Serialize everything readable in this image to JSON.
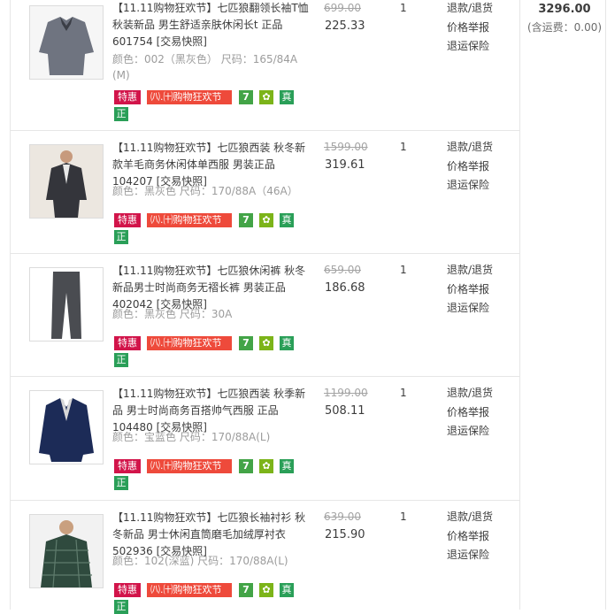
{
  "order_summary": {
    "total": "3296.00",
    "shipping_note": "(含运费：0.00)"
  },
  "items": [
    {
      "title": "【11.11购物狂欢节】七匹狼翻领长袖T恤 秋装新品 男生舒适亲肤休闲长t 正品601754 [交易快照]",
      "attrs": "颜色：002（黑灰色） 尺码：165/84A (M)",
      "price_old": "699.00",
      "price_now": "225.33",
      "qty": "1",
      "actions": [
        "退款/退货",
        "价格举报",
        "退运保险"
      ],
      "tags": {
        "sale": "特惠",
        "festival": "㈧.㈩购物狂欢节",
        "seven": "7",
        "bag": "✿",
        "genuine": "真",
        "genuine2": "正"
      },
      "thumb_colors": {
        "main": "#6f7480",
        "accent": "#3b3e46"
      }
    },
    {
      "title": "【11.11购物狂欢节】七匹狼西装 秋冬新款羊毛商务休闲体单西服 男装正品104207 [交易快照]",
      "attrs": "颜色：黑灰色 尺码：170/88A（46A）",
      "price_old": "1599.00",
      "price_now": "319.61",
      "qty": "1",
      "actions": [
        "退款/退货",
        "价格举报",
        "退运保险"
      ],
      "tags": {
        "sale": "特惠",
        "festival": "㈧.㈩购物狂欢节",
        "seven": "7",
        "bag": "✿",
        "genuine": "真",
        "genuine2": "正"
      },
      "thumb_colors": {
        "main": "#34353b",
        "accent": "#2a2b30"
      }
    },
    {
      "title": "【11.11购物狂欢节】七匹狼休闲裤 秋冬新品男士时尚商务无褶长裤 男装正品402042 [交易快照]",
      "attrs": "颜色：黑灰色 尺码：30A",
      "price_old": "659.00",
      "price_now": "186.68",
      "qty": "1",
      "actions": [
        "退款/退货",
        "价格举报",
        "退运保险"
      ],
      "tags": {
        "sale": "特惠",
        "festival": "㈧.㈩购物狂欢节",
        "seven": "7",
        "bag": "✿",
        "genuine": "真",
        "genuine2": "正"
      },
      "thumb_colors": {
        "main": "#4a4c51",
        "accent": "#3a3c40"
      }
    },
    {
      "title": "【11.11购物狂欢节】七匹狼西装 秋季新品 男士时尚商务百搭帅气西服 正品104480 [交易快照]",
      "attrs": "颜色：宝蓝色 尺码：170/88A(L)",
      "price_old": "1199.00",
      "price_now": "508.11",
      "qty": "1",
      "actions": [
        "退款/退货",
        "价格举报",
        "退运保险"
      ],
      "tags": {
        "sale": "特惠",
        "festival": "㈧.㈩购物狂欢节",
        "seven": "7",
        "bag": "✿",
        "genuine": "真",
        "genuine2": "正"
      },
      "thumb_colors": {
        "main": "#1c2b57",
        "accent": "#14203f"
      }
    },
    {
      "title": "【11.11购物狂欢节】七匹狼长袖衬衫 秋冬新品 男士休闲直筒磨毛加绒厚衬衣 502936 [交易快照]",
      "attrs": "颜色：102(深蓝) 尺码：170/88A(L)",
      "price_old": "639.00",
      "price_now": "215.90",
      "qty": "1",
      "actions": [
        "退款/退货",
        "价格举报",
        "退运保险"
      ],
      "tags": {
        "sale": "特惠",
        "festival": "㈧.㈩购物狂欢节",
        "seven": "7",
        "bag": "✿",
        "genuine": "真",
        "genuine2": "正"
      },
      "thumb_colors": {
        "main": "#2f4a3e",
        "accent": "#1e2f3d"
      }
    }
  ]
}
